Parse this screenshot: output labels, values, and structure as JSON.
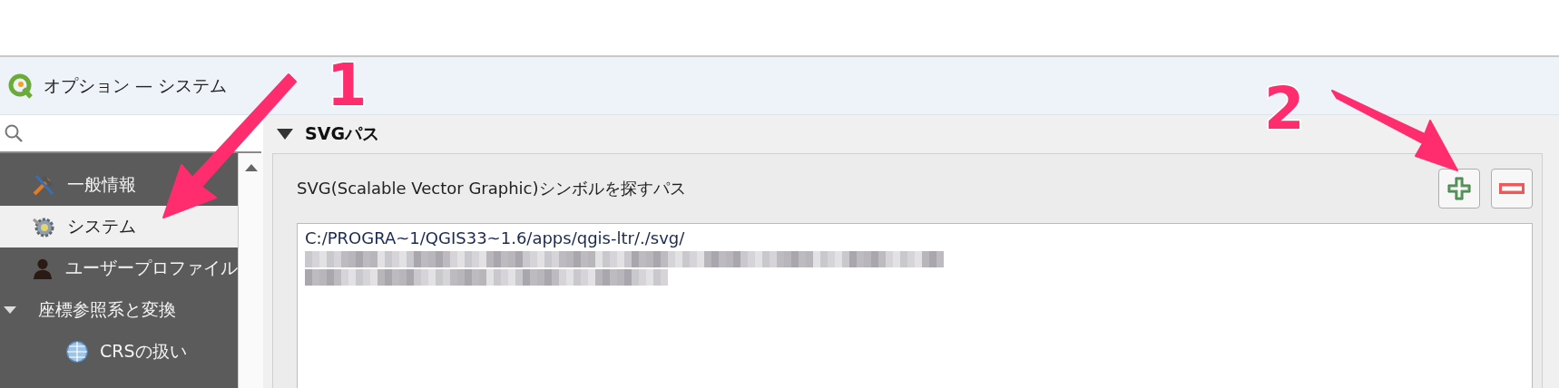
{
  "window": {
    "title": "オプション — システム"
  },
  "sidebar": {
    "items": [
      {
        "label": "一般情報",
        "selected": false
      },
      {
        "label": "システム",
        "selected": true
      },
      {
        "label": "ユーザープロファイル",
        "selected": false
      },
      {
        "label": "座標参照系と変換",
        "selected": false,
        "expanded": true,
        "children": [
          {
            "label": "CRSの扱い",
            "selected": false
          }
        ]
      }
    ]
  },
  "section": {
    "title": "SVGパス",
    "expanded": true,
    "label": "SVG(Scalable Vector Graphic)シンボルを探すパス",
    "paths": [
      "C:/PROGRA~1/QGIS33~1.6/apps/qgis-ltr/./svg/"
    ]
  },
  "annotations": [
    {
      "label": "1"
    },
    {
      "label": "2"
    }
  ]
}
